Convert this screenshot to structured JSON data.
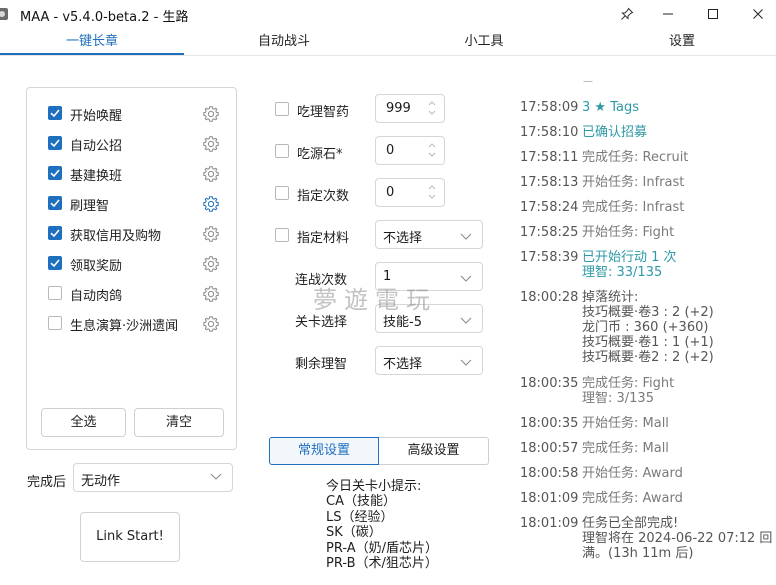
{
  "window": {
    "title": "MAA - v5.4.0-beta.2 - 生路",
    "controls": [
      "pin-icon",
      "minimize-icon",
      "maximize-icon",
      "close-icon"
    ]
  },
  "tabs": [
    {
      "label": "一键长章",
      "active": true
    },
    {
      "label": "自动战斗",
      "active": false
    },
    {
      "label": "小工具",
      "active": false
    },
    {
      "label": "设置",
      "active": false
    }
  ],
  "colors": {
    "accent": "#1f6fbf",
    "teal": "#2d9aa6",
    "checkbox": "#1f6fbf"
  },
  "tasks": [
    {
      "label": "开始唤醒",
      "checked": true
    },
    {
      "label": "自动公招",
      "checked": true
    },
    {
      "label": "基建换班",
      "checked": true
    },
    {
      "label": "刷理智",
      "checked": true,
      "gear_active": true
    },
    {
      "label": "获取信用及购物",
      "checked": true
    },
    {
      "label": "领取奖励",
      "checked": true
    },
    {
      "label": "自动肉鸽",
      "checked": false
    },
    {
      "label": "生息演算·沙洲遗闻",
      "checked": false
    }
  ],
  "task_buttons": {
    "select_all": "全选",
    "clear": "清空"
  },
  "after_complete": {
    "label": "完成后",
    "value": "无动作"
  },
  "link_start": "Link Start!",
  "fight_options": [
    {
      "label": "吃理智药",
      "checked": false,
      "value": "999"
    },
    {
      "label": "吃源石*",
      "checked": false,
      "value": "0"
    },
    {
      "label": "指定次数",
      "checked": false,
      "value": "0"
    },
    {
      "label": "指定材料",
      "checked": false,
      "value": "不选择"
    }
  ],
  "fight_selects": [
    {
      "label": "连战次数",
      "value": "1"
    },
    {
      "label": "关卡选择",
      "value": "技能-5"
    },
    {
      "label": "剩余理智",
      "value": "不选择"
    }
  ],
  "settings_tabs": {
    "normal": "常规设置",
    "advanced": "高级设置"
  },
  "tips": {
    "title": "今日关卡小提示:",
    "lines": [
      "CA（技能）",
      "LS（经验）",
      "SK（碳）",
      "PR-A（奶/盾芯片）",
      "PR-B（术/狙芯片）"
    ]
  },
  "log_partial_top": "—",
  "log": [
    {
      "time": "17:58:09",
      "lines": [
        "3 ★ Tags"
      ],
      "style": "accent"
    },
    {
      "time": "17:58:10",
      "lines": [
        "已确认招募"
      ],
      "style": "accent"
    },
    {
      "time": "17:58:11",
      "lines": [
        "完成任务: Recruit"
      ],
      "style": "gray"
    },
    {
      "time": "17:58:13",
      "lines": [
        "开始任务: Infrast"
      ],
      "style": "gray"
    },
    {
      "time": "17:58:24",
      "lines": [
        "完成任务: Infrast"
      ],
      "style": "gray"
    },
    {
      "time": "17:58:25",
      "lines": [
        "开始任务: Fight"
      ],
      "style": "gray"
    },
    {
      "time": "17:58:39",
      "lines": [
        "已开始行动 1 次",
        "理智: 33/135"
      ],
      "style": "accent"
    },
    {
      "time": "18:00:28",
      "lines": [
        "掉落统计:",
        "技巧概要·卷3 : 2 (+2)",
        "龙门币 : 360 (+360)",
        "技巧概要·卷1 : 1 (+1)",
        "技巧概要·卷2 : 2 (+2)"
      ],
      "style": "dark"
    },
    {
      "time": "18:00:35",
      "lines": [
        "完成任务: Fight",
        "理智: 3/135"
      ],
      "style": "gray"
    },
    {
      "time": "18:00:35",
      "lines": [
        "开始任务: Mall"
      ],
      "style": "gray"
    },
    {
      "time": "18:00:57",
      "lines": [
        "完成任务: Mall"
      ],
      "style": "gray"
    },
    {
      "time": "18:00:58",
      "lines": [
        "开始任务: Award"
      ],
      "style": "gray"
    },
    {
      "time": "18:01:09",
      "lines": [
        "完成任务: Award"
      ],
      "style": "gray"
    },
    {
      "time": "18:01:09",
      "lines": [
        "任务已全部完成!",
        "理智将在 2024-06-22 07:12 回",
        "满。(13h 11m 后)"
      ],
      "style": "dark"
    }
  ],
  "watermark": "夢遊電玩"
}
